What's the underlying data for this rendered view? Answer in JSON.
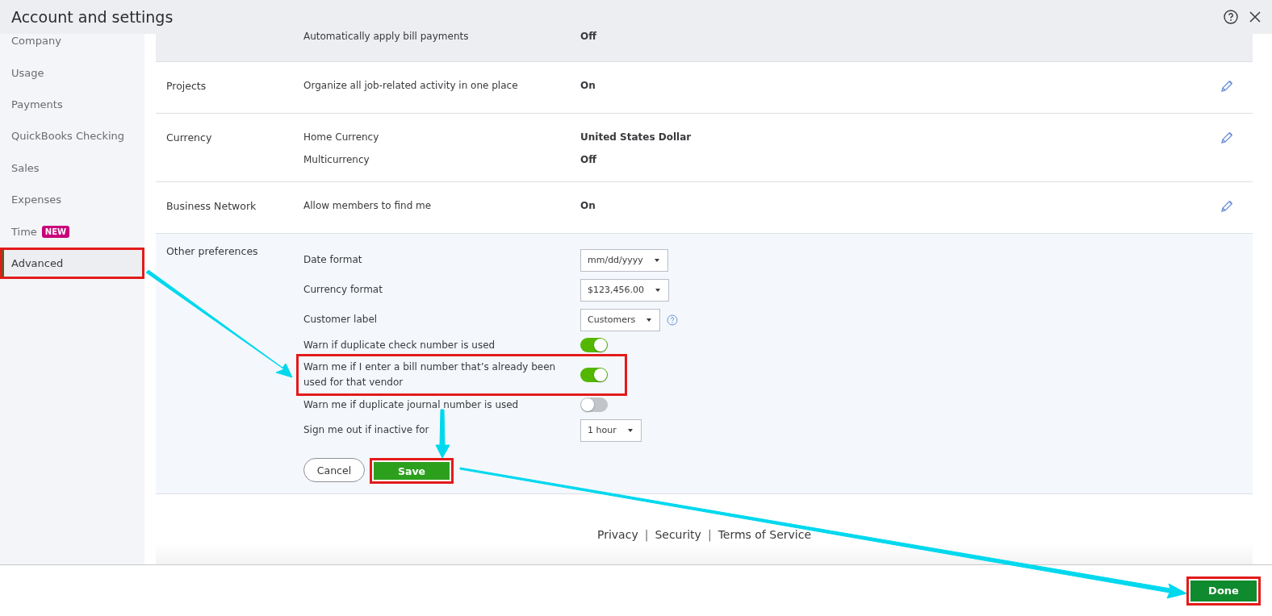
{
  "header": {
    "title": "Account and settings"
  },
  "sidebar": {
    "items": [
      {
        "label": "Company",
        "selected": false,
        "highlighted": false
      },
      {
        "label": "Usage",
        "selected": false,
        "highlighted": false
      },
      {
        "label": "Payments",
        "selected": false,
        "highlighted": false
      },
      {
        "label": "QuickBooks Checking",
        "selected": false,
        "highlighted": false
      },
      {
        "label": "Sales",
        "selected": false,
        "highlighted": false
      },
      {
        "label": "Expenses",
        "selected": false,
        "highlighted": false
      },
      {
        "label": "Time",
        "badge": "NEW",
        "selected": false,
        "highlighted": false
      },
      {
        "label": "Advanced",
        "selected": true,
        "highlighted": true
      }
    ]
  },
  "sections": [
    {
      "editable": false,
      "rows": [
        {
          "label": "Automatically apply bill payments",
          "value": "Off"
        }
      ]
    },
    {
      "title": "Projects",
      "editable": true,
      "rows": [
        {
          "label": "Organize all job-related activity in one place",
          "value": "On"
        }
      ]
    },
    {
      "title": "Currency",
      "editable": true,
      "rows": [
        {
          "label": "Home Currency",
          "value": "United States Dollar"
        },
        {
          "label": "Multicurrency",
          "value": "Off"
        }
      ]
    },
    {
      "title": "Business Network",
      "editable": true,
      "rows": [
        {
          "label": "Allow members to find me",
          "value": "On"
        }
      ]
    }
  ],
  "other_preferences": {
    "title": "Other preferences",
    "rows": [
      {
        "kind": "select",
        "label": "Date format",
        "value": "mm/dd/yyyy",
        "help": false,
        "highlighted": false
      },
      {
        "kind": "select",
        "label": "Currency format",
        "value": "$123,456.00",
        "help": false,
        "highlighted": false
      },
      {
        "kind": "select",
        "label": "Customer label",
        "value": "Customers",
        "help": true,
        "highlighted": false
      },
      {
        "kind": "toggle",
        "label": "Warn if duplicate check number is used",
        "on": true,
        "highlighted": false
      },
      {
        "kind": "toggle",
        "label": "Warn me if I enter a bill number that’s already been used for that vendor",
        "on": true,
        "highlighted": true
      },
      {
        "kind": "toggle",
        "label": "Warn me if duplicate journal number is used",
        "on": false,
        "highlighted": false
      },
      {
        "kind": "select",
        "label": "Sign me out if inactive for",
        "value": "1 hour",
        "help": false,
        "highlighted": false
      }
    ],
    "cancel": {
      "label": "Cancel"
    },
    "save": {
      "label": "Save",
      "highlighted": true
    }
  },
  "footer": [
    {
      "kind": "link",
      "text": "Privacy"
    },
    {
      "kind": "separator",
      "text": "|"
    },
    {
      "kind": "link",
      "text": "Security"
    },
    {
      "kind": "separator",
      "text": "|"
    },
    {
      "kind": "link",
      "text": "Terms of Service"
    }
  ],
  "done": {
    "label": "Done",
    "highlighted": true
  }
}
